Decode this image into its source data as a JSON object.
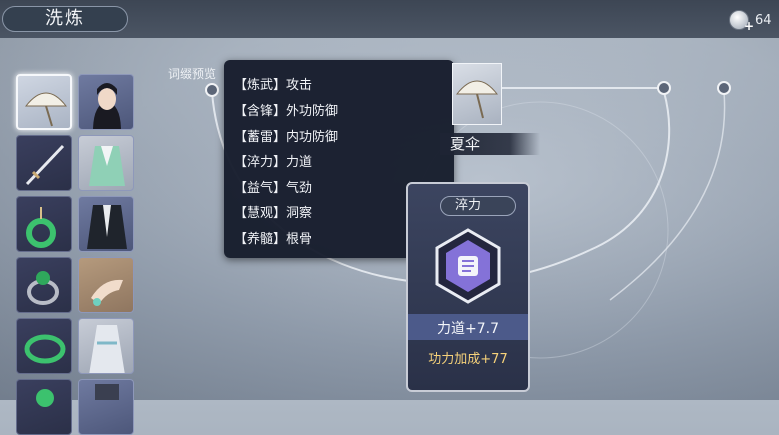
{
  "header": {
    "title": "洗炼",
    "currency_amount": "64",
    "currency_icon": "coin-icon"
  },
  "equipment_slots": [
    {
      "name": "umbrella",
      "icon": "umbrella-icon",
      "selected": true
    },
    {
      "name": "sword",
      "icon": "sword-icon",
      "selected": false
    },
    {
      "name": "pendant",
      "icon": "jade-pendant-icon",
      "selected": false
    },
    {
      "name": "ring",
      "icon": "ring-icon",
      "selected": false
    },
    {
      "name": "bracelet",
      "icon": "bracelet-icon",
      "selected": false
    },
    {
      "name": "accessory",
      "icon": "jade-accessory-icon",
      "selected": false
    }
  ],
  "outfit_slots": [
    {
      "name": "head",
      "icon": "character-head-icon"
    },
    {
      "name": "top",
      "icon": "robe-top-icon"
    },
    {
      "name": "coat",
      "icon": "dark-robe-icon"
    },
    {
      "name": "hands",
      "icon": "hand-icon"
    },
    {
      "name": "skirt",
      "icon": "skirt-icon"
    },
    {
      "name": "shoes",
      "icon": "shoes-icon"
    }
  ],
  "preview": {
    "label": "词缀预览",
    "affixes": [
      {
        "prefix": "【炼武】",
        "stat": "攻击"
      },
      {
        "prefix": "【含锋】",
        "stat": "外功防御"
      },
      {
        "prefix": "【蓄雷】",
        "stat": "内功防御"
      },
      {
        "prefix": "【淬力】",
        "stat": "力道"
      },
      {
        "prefix": "【益气】",
        "stat": "气劲"
      },
      {
        "prefix": "【慧观】",
        "stat": "洞察"
      },
      {
        "prefix": "【养髓】",
        "stat": "根骨"
      }
    ]
  },
  "item": {
    "name": "夏伞"
  },
  "affix_card": {
    "tab_label": "淬力",
    "stat_line": "力道+7.7",
    "bonus_line": "功力加成+77",
    "icon": "fist-icon"
  },
  "colors": {
    "accent_gold": "#f6d27a",
    "tooltip_bg": "#161c2c"
  }
}
